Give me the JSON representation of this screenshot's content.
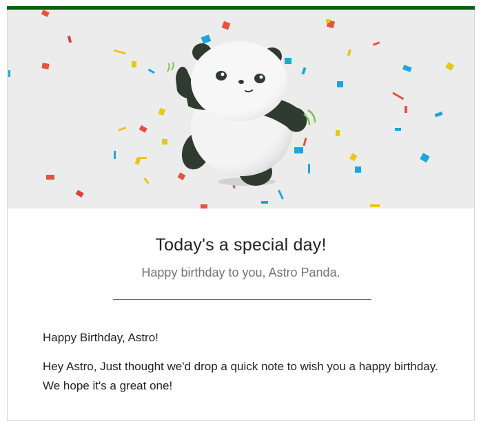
{
  "colors": {
    "accent_bar": "#0b5d0b",
    "divider": "#2f6b2f",
    "hero_bg": "#ececec",
    "title": "#222222",
    "subtitle": "#737373"
  },
  "hero": {
    "illustration": "panda-celebration-illustration",
    "decorations": "confetti"
  },
  "card": {
    "title": "Today's a special day!",
    "subtitle": "Happy birthday to you, Astro Panda."
  },
  "message": {
    "greeting": "Happy Birthday, Astro!",
    "body": "Hey Astro, Just thought we'd drop a quick note to wish you a happy birthday. We hope it's a great one!"
  }
}
